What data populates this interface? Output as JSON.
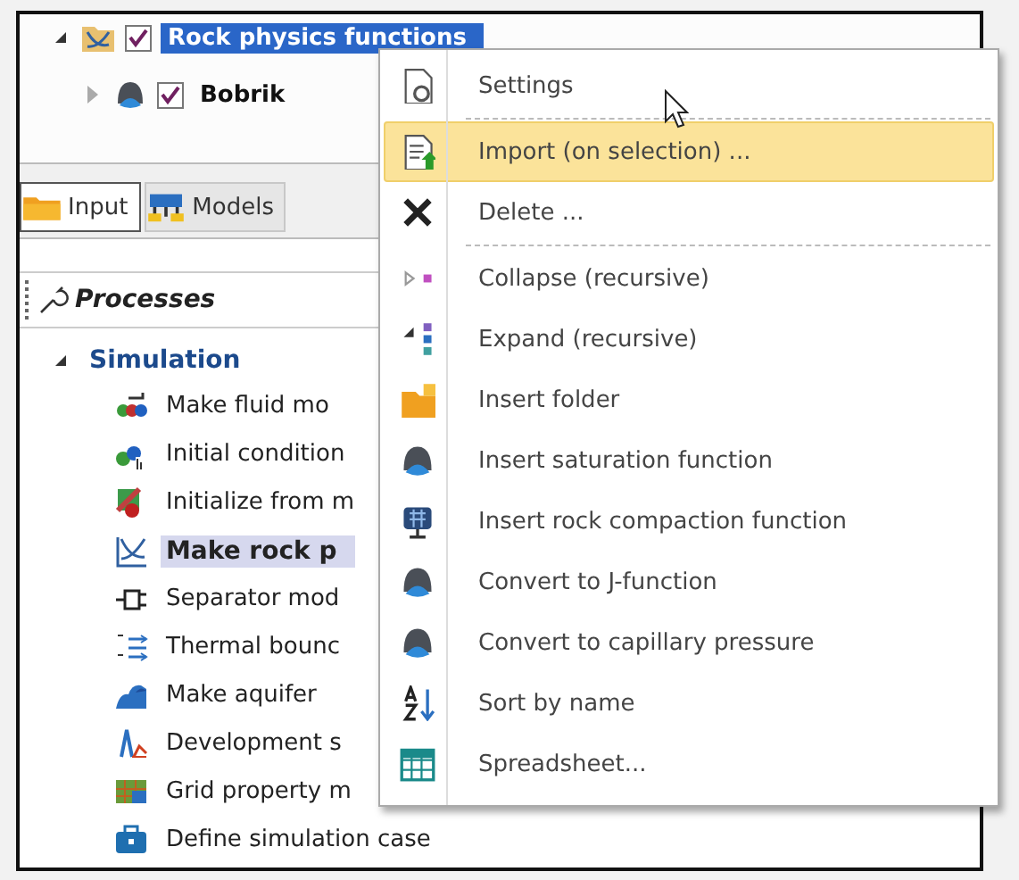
{
  "tree": [
    {
      "label": "Rock physics functions",
      "expanded": true,
      "checked": true,
      "selected": true
    },
    {
      "label": "Bobrik",
      "expanded": false,
      "checked": true,
      "selected": false
    }
  ],
  "tabs": [
    {
      "label": "Input",
      "selected": true
    },
    {
      "label": "Models",
      "selected": false
    }
  ],
  "processes": {
    "title": "Processes",
    "groups": [
      {
        "label": "Simulation",
        "expanded": true,
        "children": [
          {
            "label": "Make fluid mo",
            "selected": false
          },
          {
            "label": "Initial condition",
            "selected": false
          },
          {
            "label": "Initialize from m",
            "selected": false
          },
          {
            "label": "Make rock p",
            "selected": true
          },
          {
            "label": "Separator mod",
            "selected": false
          },
          {
            "label": "Thermal bounc",
            "selected": false
          },
          {
            "label": "Make aquifer",
            "selected": false
          },
          {
            "label": "Development s",
            "selected": false
          },
          {
            "label": "Grid property m",
            "selected": false
          },
          {
            "label": "Define simulation case",
            "selected": false
          }
        ]
      }
    ]
  },
  "menu": {
    "items": [
      {
        "label": "Settings",
        "highlighted": false,
        "separator_after": true
      },
      {
        "label": "Import (on selection) ...",
        "highlighted": true,
        "separator_after": false
      },
      {
        "label": "Delete ...",
        "highlighted": false,
        "separator_after": true
      },
      {
        "label": "Collapse (recursive)",
        "highlighted": false,
        "separator_after": false
      },
      {
        "label": "Expand (recursive)",
        "highlighted": false,
        "separator_after": false
      },
      {
        "label": "Insert folder",
        "highlighted": false,
        "separator_after": false
      },
      {
        "label": "Insert saturation function",
        "highlighted": false,
        "separator_after": false
      },
      {
        "label": "Insert rock compaction function",
        "highlighted": false,
        "separator_after": false
      },
      {
        "label": "Convert to J-function",
        "highlighted": false,
        "separator_after": false
      },
      {
        "label": "Convert to capillary pressure",
        "highlighted": false,
        "separator_after": false
      },
      {
        "label": "Sort by name",
        "highlighted": false,
        "separator_after": false
      },
      {
        "label": "Spreadsheet...",
        "highlighted": false,
        "separator_after": false
      }
    ]
  }
}
